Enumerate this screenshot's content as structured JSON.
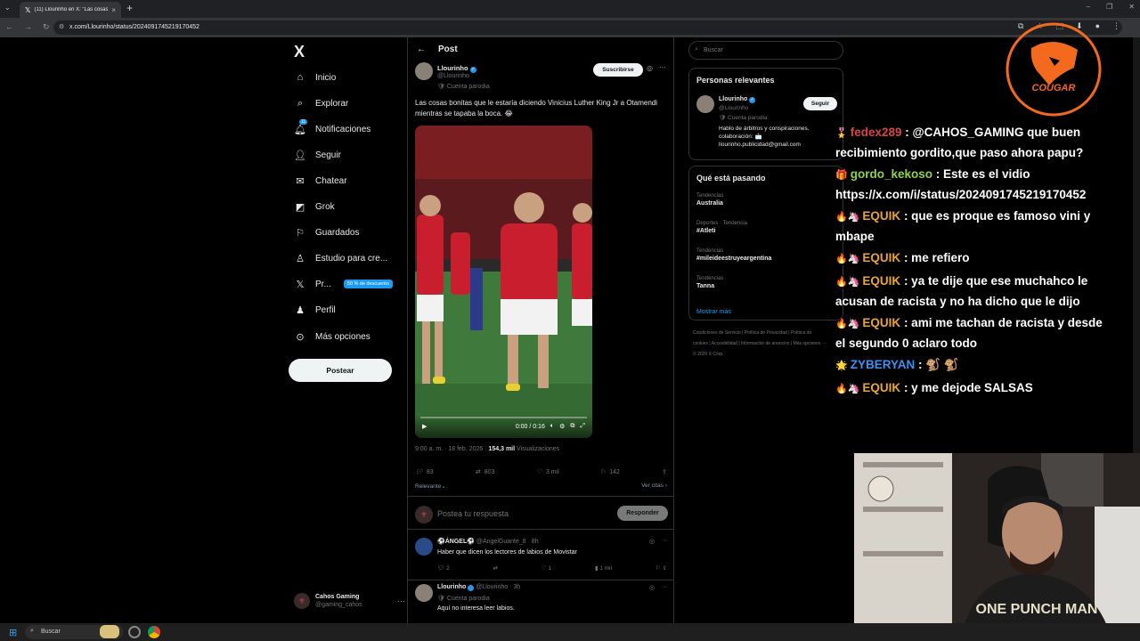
{
  "browser": {
    "tab_title": "(11) Llourinho en X: \"Las cosas",
    "url": "x.com/Llourinho/status/2024091745219170452"
  },
  "nav": {
    "logo": "X",
    "items": [
      {
        "label": "Inicio",
        "icon": "home-icon"
      },
      {
        "label": "Explorar",
        "icon": "search-icon"
      },
      {
        "label": "Notificaciones",
        "icon": "bell-icon",
        "badge": "11"
      },
      {
        "label": "Seguir",
        "icon": "follow-icon"
      },
      {
        "label": "Chatear",
        "icon": "mail-icon"
      },
      {
        "label": "Grok",
        "icon": "grok-icon"
      },
      {
        "label": "Guardados",
        "icon": "bookmark-icon"
      },
      {
        "label": "Estudio para cre...",
        "icon": "studio-icon"
      },
      {
        "label": "Pr...",
        "icon": "x-premium-icon",
        "promo": "50 % de descuento"
      },
      {
        "label": "Perfil",
        "icon": "profile-icon"
      },
      {
        "label": "Más opciones",
        "icon": "more-icon"
      }
    ],
    "post_button": "Postear",
    "account_name": "Cahos Gaming",
    "account_handle": "@gaming_cahos"
  },
  "post": {
    "header": "Post",
    "author_name": "Llourinho",
    "author_handle": "@Llourinho",
    "parody_label": "Cuenta parodia",
    "subscribe_label": "Suscribirse",
    "text": "Las cosas bonitas que le estaría diciendo Vinicius Luther King Jr a Otamendi mientras se tapaba la boca. 😂",
    "video_time": "0:00 / 0:16",
    "timestamp": "9:00 a. m. · 18 feb. 2026 · ",
    "views": "154,3 mil",
    "views_label": " Visualizaciones",
    "stats": {
      "replies": "83",
      "reposts": "803",
      "likes": "3 mil",
      "bookmarks": "142"
    },
    "sort_label": "Relevante",
    "quotes_label": "Ver citas",
    "reply_placeholder": "Postea tu respuesta",
    "reply_button": "Responder"
  },
  "replies": [
    {
      "name": "⚽ÁNGEL⚽",
      "handle": "@AngelGuante_8 · 8h",
      "text": "Haber que dicen los lectores de labios de Movistar",
      "stats": {
        "replies": "2",
        "reposts": "",
        "likes": "1",
        "views": "1 mil"
      }
    },
    {
      "name": "Llourinho",
      "handle": "@Llourinho · 3h",
      "parody": "Cuenta parodia",
      "text": "Aquí no interesa leer labios."
    }
  ],
  "sidebar": {
    "search_placeholder": "Buscar",
    "relevant_title": "Personas relevantes",
    "relevant": {
      "name": "Llourinho",
      "handle": "@Llourinho",
      "parody": "Cuenta parodia",
      "follow_label": "Seguir",
      "bio": "Hablo de árbitros y conspiraciones. colaboración: 📩 llourinho.publicidad@gmail.com"
    },
    "trends_title": "Qué está pasando",
    "trends": [
      {
        "category": "Tendencias",
        "name": "Australia"
      },
      {
        "category": "Deportes · Tendencia",
        "name": "#Atleti"
      },
      {
        "category": "Tendencias",
        "name": "#mileideestruyeargentina"
      },
      {
        "category": "Tendencias",
        "name": "Tanna"
      }
    ],
    "show_more": "Mostrar más",
    "footer": "Condiciones de Servicio | Política de Privacidad | Política de cookies | Accesibilidad | Información de anuncios | Más opciones ··· © 2026 X Corp."
  },
  "overlay": {
    "brand": "COUGAR",
    "chat": [
      {
        "badges": "🎖️",
        "user": "fedex289",
        "color": "#d64545",
        "message": ": @CAHOS_GAMING que buen recibimiento gordito,que paso ahora papu?"
      },
      {
        "badges": "🎁",
        "user": "gordo_kekoso",
        "color": "#8ed14f",
        "message": ": Este es el vidio https://x.com/i/status/2024091745219170452"
      },
      {
        "badges": "🔥🦄",
        "user": "EQUIK",
        "color": "#e8a33d",
        "message": ": que es proque es famoso vini y mbape"
      },
      {
        "badges": "🔥🦄",
        "user": "EQUIK",
        "color": "#e8a33d",
        "message": ": me refiero"
      },
      {
        "badges": "🔥🦄",
        "user": "EQUIK",
        "color": "#e8a33d",
        "message": ": ya te dije que ese muchahco le acusan de racista y no ha dicho que le dijo"
      },
      {
        "badges": "🔥🦄",
        "user": "EQUIK",
        "color": "#e8a33d",
        "message": ": ami me tachan de racista y desde el segundo 0 aclaro todo"
      },
      {
        "badges": "🌟",
        "user": "ZYBERYAN",
        "color": "#3d8ff0",
        "message": ": 🐒 🐒"
      },
      {
        "badges": "🔥🦄",
        "user": "EQUIK",
        "color": "#e8a33d",
        "message": ": y me dejode SALSAS"
      }
    ]
  },
  "taskbar": {
    "search_label": "Buscar"
  }
}
